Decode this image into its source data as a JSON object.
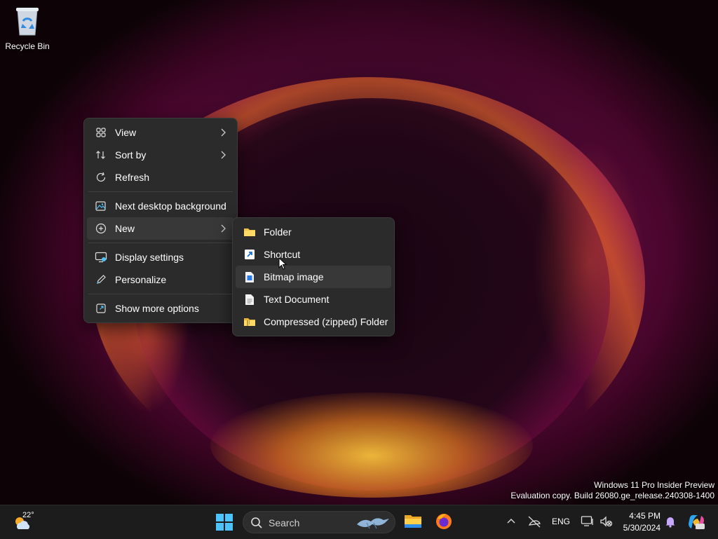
{
  "desktop": {
    "icons": [
      {
        "label": "Recycle Bin",
        "icon": "recycle-bin-icon"
      }
    ],
    "watermark": {
      "line1": "Windows 11 Pro Insider Preview",
      "line2": "Evaluation copy. Build 26080.ge_release.240308-1400"
    }
  },
  "context_menu": {
    "items": [
      {
        "label": "View",
        "icon": "grid-view-icon",
        "has_submenu": true
      },
      {
        "label": "Sort by",
        "icon": "sort-icon",
        "has_submenu": true
      },
      {
        "label": "Refresh",
        "icon": "refresh-icon"
      },
      {
        "label": "Next desktop background",
        "icon": "next-background-icon"
      },
      {
        "label": "New",
        "icon": "new-plus-icon",
        "has_submenu": true,
        "highlighted": true
      },
      {
        "label": "Display settings",
        "icon": "display-settings-icon"
      },
      {
        "label": "Personalize",
        "icon": "pen-icon"
      },
      {
        "label": "Show more options",
        "icon": "show-more-options-icon"
      }
    ]
  },
  "new_submenu": {
    "items": [
      {
        "label": "Folder",
        "icon": "folder-icon"
      },
      {
        "label": "Shortcut",
        "icon": "shortcut-icon"
      },
      {
        "label": "Bitmap image",
        "icon": "bitmap-image-icon",
        "highlighted": true
      },
      {
        "label": "Text Document",
        "icon": "text-document-icon"
      },
      {
        "label": "Compressed (zipped) Folder",
        "icon": "zip-folder-icon"
      }
    ]
  },
  "taskbar": {
    "weather_temp": "22°",
    "search_placeholder": "Search",
    "language": "ENG",
    "time": "4:45 PM",
    "date": "5/30/2024"
  },
  "colors": {
    "menu_bg": "#2b2b2b",
    "menu_highlight": "#383838",
    "taskbar_bg": "#1c1c1c",
    "accent": "#4cc2ff"
  }
}
